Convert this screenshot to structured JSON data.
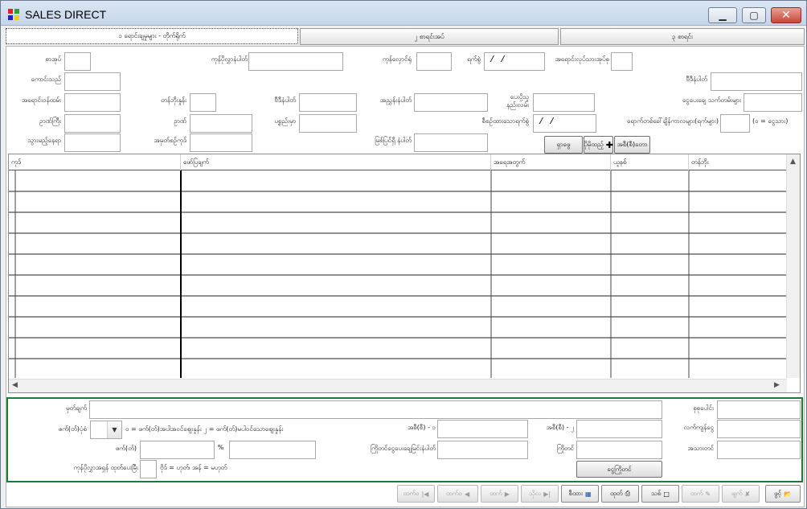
{
  "window": {
    "title": "SALES DIRECT",
    "min": "▁",
    "max": "▢",
    "close": "✕"
  },
  "tabs": [
    {
      "label": "၁ ရောင်းချမှုများ - တိုက်ရိုက်"
    },
    {
      "label": "၂ စာရင်းအပ်"
    },
    {
      "label": "၃ စာရင်း"
    }
  ],
  "form": {
    "sanad_label": "စာအုပ်",
    "customer_id_label": "ကုန်ပိုလွှာနံပါတ်",
    "order_no_label": "ကုန်လှောင်ရုံ",
    "date_label": "ရက်စွဲ",
    "date_value": "/ /",
    "credit_days_label": "အရောင်းလုပ်သားအုပ်စု",
    "agent_label": "ကောင်းသည်",
    "invoice_no_label": "ဗီဒီနံပါတ်",
    "address_label": "အရောင်းဝန်ထမ်း",
    "price_type_label": "တန်ဘိုးနှုန်း",
    "bill_no_label": "ဗီဒီနံပါတ်",
    "ref_no_label": "အညွှန်းနံပါတ်",
    "salesperson_label": "ပေးပို့သူ\nနည်းလမ်း",
    "delivery_notes_label": "ငွေပေးချေ သက်တမ်းများ",
    "project_label": "ဥာဏ်ကြီး",
    "dept_label": "ဥာဏ်",
    "remarks_label": "ပစ္စည်းမှာ",
    "due_date_label": "စီစဉ်ထားသောရက်စွဲ",
    "due_date_value": "/ /",
    "credit_term_label": "ရောက်တစ်ခေါ်ချိန်ကာလများ(ရက်များ)",
    "credit_term_hint": "(၀ = ငွေသား)",
    "area_label": "သွားမည့်နေရာ",
    "branch_label": "အမှတ်စဉ်ကုဒ်",
    "serial_no_label": "မြစ်ပြင်ရှိ နံပါတ်",
    "btn_search": "ရှာဖွေ",
    "btn_add": "ပိုမိုထည့်",
    "btn_detail": "အစီ(စီ)တော"
  },
  "grid": {
    "columns": [
      "ကုဒ်",
      "ဖော်ပြချက်",
      "အရေအတွက်",
      "ယူနစ်",
      "တန်ဘိုး"
    ],
    "row_count": 10
  },
  "summary": {
    "note_label": "မှတ်ချက်",
    "payment_type_label": "ဖက်(တ်)ပုံစံ",
    "payment_type_hint": "၀ = ဖက်(တ်)အပါအဝင်စျေးနှုန်း ၂ = ဖက်(တ်)မပါဝင်သောစျေးနှုန်း",
    "vat_label": "ဖက်(တ်)",
    "vat_pct": "%",
    "rounding_label": "ကုန်ပိုလွှာအရှန် ထုတ်ပေးမြီး",
    "rounding_hint": "ဗိုဒ် = ဟုတ်၊ အန် = မဟုတ်",
    "disc1_label": "အစီ(စီ) - ၁",
    "disc2_label": "အစီ(စီ) - ၂",
    "payment_doc_label": "ကြိုတင်ငွေပေးချေမြင်းနံပါတ်",
    "advance_label": "ကြိုတင်",
    "btn_advance": "ငွေကြိုတင်",
    "total_label": "စုစုပေါင်း",
    "paid_label": "လက်ကျန်ငွေ",
    "balance_label": "အသားတင်"
  },
  "nav": [
    {
      "label": "ထက်ဝ",
      "icon": "first-icon",
      "enabled": false
    },
    {
      "label": "ထက်ဝ",
      "icon": "prev-icon",
      "enabled": false
    },
    {
      "label": "ထက်",
      "icon": "next-icon",
      "enabled": false
    },
    {
      "label": "သိုလ",
      "icon": "last-icon",
      "enabled": false
    },
    {
      "label": "စီထား",
      "icon": "find-icon",
      "enabled": true
    },
    {
      "label": "ထုတ်",
      "icon": "print-icon",
      "enabled": true
    },
    {
      "label": "သစ်",
      "icon": "new-icon",
      "enabled": true
    },
    {
      "label": "ထက်",
      "icon": "edit-icon",
      "enabled": false
    },
    {
      "label": "ဖျက်",
      "icon": "delete-icon",
      "enabled": false
    },
    {
      "label": "ဖွင့်",
      "icon": "open-icon",
      "enabled": true
    }
  ]
}
